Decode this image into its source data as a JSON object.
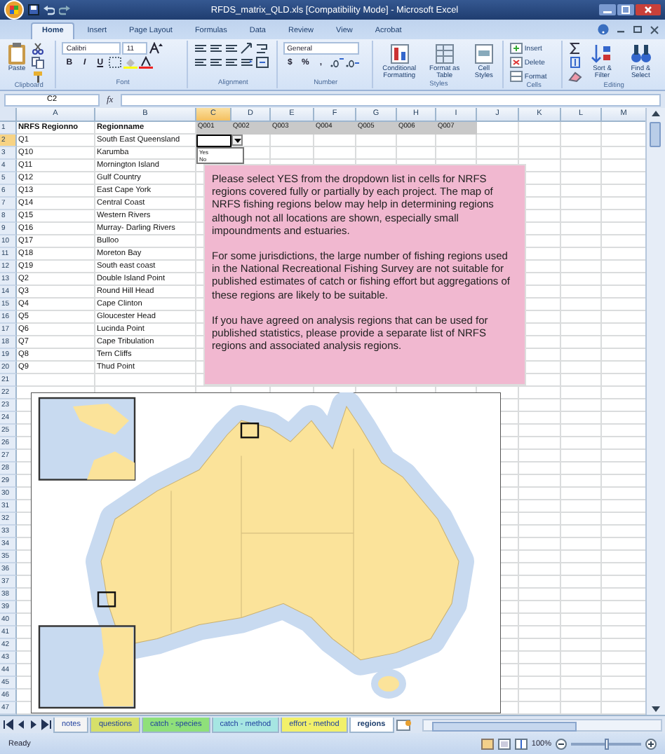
{
  "window": {
    "title": "RFDS_matrix_QLD.xls [Compatibility Mode] - Microsoft Excel"
  },
  "tabs": [
    {
      "label": "Home",
      "selected": true
    },
    {
      "label": "Insert",
      "selected": false
    },
    {
      "label": "Page Layout",
      "selected": false
    },
    {
      "label": "Formulas",
      "selected": false
    },
    {
      "label": "Data",
      "selected": false
    },
    {
      "label": "Review",
      "selected": false
    },
    {
      "label": "View",
      "selected": false
    },
    {
      "label": "Acrobat",
      "selected": false
    }
  ],
  "ribbon": {
    "groups": [
      {
        "kind": "clipboard",
        "label": "Clipboard",
        "items": [
          "Paste"
        ]
      },
      {
        "kind": "font",
        "label": "Font",
        "fields": [
          "Calibri",
          "11"
        ],
        "items": [
          "B",
          "I",
          "U"
        ]
      },
      {
        "kind": "alignment",
        "label": "Alignment"
      },
      {
        "kind": "number",
        "label": "Number",
        "fields": [
          "General"
        ],
        "items": [
          "$",
          "%",
          ","
        ]
      },
      {
        "kind": "styles",
        "label": "Styles",
        "items": [
          "Conditional Formatting",
          "Format as Table",
          "Cell Styles"
        ]
      },
      {
        "kind": "cells",
        "label": "Cells",
        "items": [
          "Insert",
          "Delete",
          "Format"
        ]
      },
      {
        "kind": "editing",
        "label": "Editing",
        "items": [
          "Sort & Filter",
          "Find & Select"
        ]
      }
    ]
  },
  "formula_bar": {
    "name_box": "C2",
    "function_symbol": "fx"
  },
  "columns": [
    {
      "label": "A",
      "selected": false
    },
    {
      "label": "B",
      "selected": false
    },
    {
      "label": "C",
      "selected": true
    },
    {
      "label": "D",
      "selected": false
    },
    {
      "label": "E",
      "selected": false
    },
    {
      "label": "F",
      "selected": false
    },
    {
      "label": "G",
      "selected": false
    },
    {
      "label": "H",
      "selected": false
    },
    {
      "label": "I",
      "selected": false
    },
    {
      "label": "J",
      "selected": false
    },
    {
      "label": "K",
      "selected": false
    },
    {
      "label": "L",
      "selected": false
    },
    {
      "label": "M",
      "selected": false
    }
  ],
  "rows": [
    {
      "number": "1",
      "selected": false,
      "kind": "header",
      "cells": [
        "NRFS Regionno",
        "Regionname",
        "Q001",
        "Q002",
        "Q003",
        "Q004",
        "Q005",
        "Q006",
        "Q007"
      ]
    },
    {
      "number": "2",
      "selected": true,
      "cells": [
        "Q1",
        "South East Queensland"
      ],
      "dropdown": {
        "expanded": true,
        "options": [
          "Yes",
          "No"
        ]
      }
    },
    {
      "number": "3",
      "selected": false,
      "cells": [
        "Q10",
        "Karumba"
      ]
    },
    {
      "number": "4",
      "selected": false,
      "cells": [
        "Q11",
        "Mornington Island"
      ]
    },
    {
      "number": "5",
      "selected": false,
      "cells": [
        "Q12",
        "Gulf Country"
      ]
    },
    {
      "number": "6",
      "selected": false,
      "cells": [
        "Q13",
        "East Cape York"
      ]
    },
    {
      "number": "7",
      "selected": false,
      "cells": [
        "Q14",
        "Central Coast"
      ]
    },
    {
      "number": "8",
      "selected": false,
      "cells": [
        "Q15",
        "Western Rivers"
      ]
    },
    {
      "number": "9",
      "selected": false,
      "cells": [
        "Q16",
        "Murray- Darling Rivers"
      ]
    },
    {
      "number": "10",
      "selected": false,
      "cells": [
        "Q17",
        "Bulloo"
      ]
    },
    {
      "number": "11",
      "selected": false,
      "cells": [
        "Q18",
        "Moreton Bay"
      ]
    },
    {
      "number": "12",
      "selected": false,
      "cells": [
        "Q19",
        "South east coast"
      ]
    },
    {
      "number": "13",
      "selected": false,
      "cells": [
        "Q2",
        "Double Island Point"
      ]
    },
    {
      "number": "14",
      "selected": false,
      "cells": [
        "Q3",
        "Round Hill Head"
      ]
    },
    {
      "number": "15",
      "selected": false,
      "cells": [
        "Q4",
        "Cape Clinton"
      ]
    },
    {
      "number": "16",
      "selected": false,
      "cells": [
        "Q5",
        "Gloucester Head"
      ]
    },
    {
      "number": "17",
      "selected": false,
      "cells": [
        "Q6",
        "Lucinda Point"
      ]
    },
    {
      "number": "18",
      "selected": false,
      "cells": [
        "Q7",
        "Cape Tribulation"
      ]
    },
    {
      "number": "19",
      "selected": false,
      "cells": [
        "Q8",
        "Tern Cliffs"
      ]
    },
    {
      "number": "20",
      "selected": false,
      "cells": [
        "Q9",
        "Thud Point"
      ]
    },
    {
      "number": "21",
      "selected": false
    },
    {
      "number": "22",
      "selected": false
    },
    {
      "number": "23",
      "selected": false
    },
    {
      "number": "24",
      "selected": false
    },
    {
      "number": "25",
      "selected": false
    },
    {
      "number": "26",
      "selected": false
    },
    {
      "number": "27",
      "selected": false
    },
    {
      "number": "28",
      "selected": false
    },
    {
      "number": "29",
      "selected": false
    },
    {
      "number": "30",
      "selected": false
    },
    {
      "number": "31",
      "selected": false
    },
    {
      "number": "32",
      "selected": false
    },
    {
      "number": "33",
      "selected": false
    },
    {
      "number": "34",
      "selected": false
    },
    {
      "number": "35",
      "selected": false
    },
    {
      "number": "36",
      "selected": false
    },
    {
      "number": "37",
      "selected": false
    },
    {
      "number": "38",
      "selected": false
    },
    {
      "number": "39",
      "selected": false
    },
    {
      "number": "40",
      "selected": false
    },
    {
      "number": "41",
      "selected": false
    },
    {
      "number": "42",
      "selected": false
    },
    {
      "number": "43",
      "selected": false
    },
    {
      "number": "44",
      "selected": false
    },
    {
      "number": "45",
      "selected": false
    },
    {
      "number": "46",
      "selected": false
    },
    {
      "number": "47",
      "selected": false
    }
  ],
  "note": {
    "paragraphs": [
      "Please select YES from the dropdown list in cells for NRFS regions covered fully or partially by each project. The map of NRFS fishing regions below may help in determining regions although not all locations are shown, especially small impoundments and estuaries.",
      "For some jurisdictions, the large number of fishing regions used in the National Recreational Fishing Survey are not suitable for published estimates of catch or fishing effort but aggregations of these regions are likely to be suitable.",
      "If you have agreed on analysis regions that can be used for published statistics,  please provide a separate list of NRFS regions and associated analysis regions."
    ]
  },
  "sheet_tabs": [
    {
      "label": "notes",
      "selected": false,
      "color": "#f4f4f4"
    },
    {
      "label": "questions",
      "selected": false,
      "color": "#d6e06a"
    },
    {
      "label": "catch - species",
      "selected": false,
      "color": "#8fe07a"
    },
    {
      "label": "catch - method",
      "selected": false,
      "color": "#a6e6e2"
    },
    {
      "label": "effort - method",
      "selected": false,
      "color": "#f2f06a"
    },
    {
      "label": "regions",
      "selected": true,
      "color": "#ffffff"
    }
  ],
  "status_bar": {
    "text": "Ready",
    "zoom": "100%",
    "level": 0.5
  }
}
